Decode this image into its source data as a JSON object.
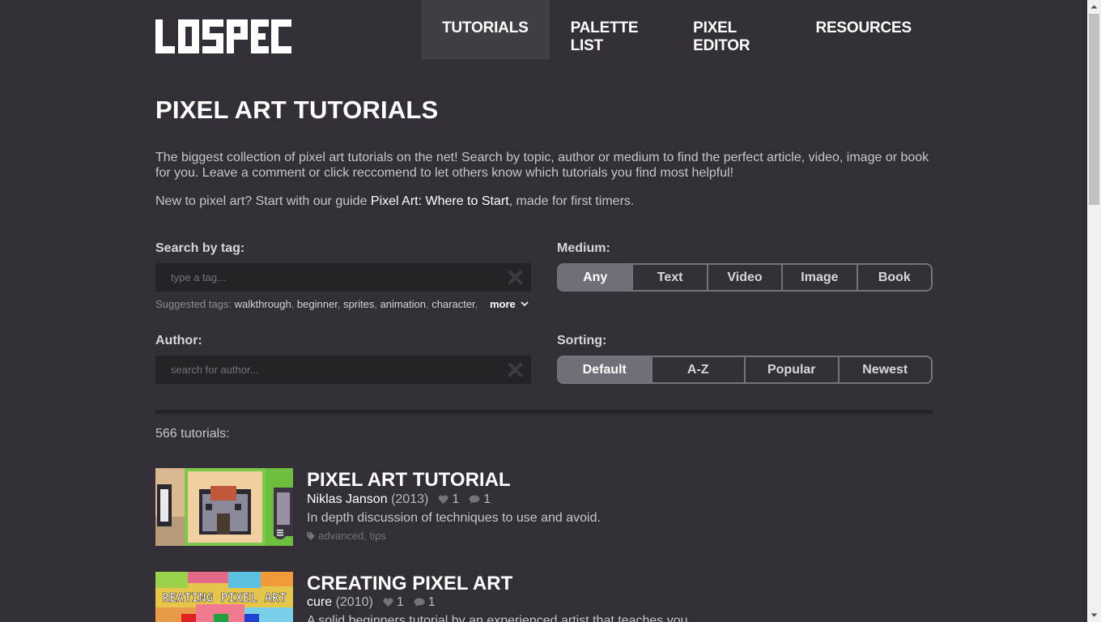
{
  "nav": {
    "logo_text": "LOSPEC",
    "items": [
      {
        "label": "TUTORIALS",
        "active": true
      },
      {
        "label": "PALETTE LIST",
        "active": false
      },
      {
        "label": "PIXEL EDITOR",
        "active": false
      },
      {
        "label": "RESOURCES",
        "active": false
      }
    ]
  },
  "page": {
    "title": "PIXEL ART TUTORIALS",
    "intro": "The biggest collection of pixel art tutorials on the net! Search by topic, author or medium to find the perfect article, video, image or book for you. Leave a comment or click reccomend to let others know which tutorials you find most helpful!",
    "newline_prefix": "New to pixel art? Start with our guide ",
    "newline_link": "Pixel Art: Where to Start",
    "newline_suffix": ", made for first timers."
  },
  "filters": {
    "tag_label": "Search by tag:",
    "tag_placeholder": "type a tag...",
    "suggested_prefix": "Suggested tags: ",
    "suggested_tags": [
      "walkthrough",
      "beginner",
      "sprites",
      "animation",
      "character"
    ],
    "more_label": "more",
    "author_label": "Author:",
    "author_placeholder": "search for author...",
    "medium_label": "Medium:",
    "medium_options": [
      "Any",
      "Text",
      "Video",
      "Image",
      "Book"
    ],
    "medium_selected": "Any",
    "sorting_label": "Sorting:",
    "sorting_options": [
      "Default",
      "A-Z",
      "Popular",
      "Newest"
    ],
    "sorting_selected": "Default"
  },
  "results": {
    "count_text": "566 tutorials:",
    "items": [
      {
        "title": "PIXEL ART TUTORIAL",
        "author": "Niklas Janson",
        "year": "(2013)",
        "likes": "1",
        "comments": "1",
        "description": "In depth discussion of techniques to use and avoid.",
        "tags": "advanced, tips"
      },
      {
        "title": "CREATING PIXEL ART",
        "author": "cure",
        "year": "(2010)",
        "likes": "1",
        "comments": "1",
        "description": "A solid beginners tutorial by an experienced artist that teaches you",
        "thumb_text": "REATING PIXEL ART"
      }
    ]
  },
  "colors": {
    "background": "#342f36",
    "field": "#262228",
    "active_nav": "#433d45",
    "segment_on": "#726d77"
  }
}
